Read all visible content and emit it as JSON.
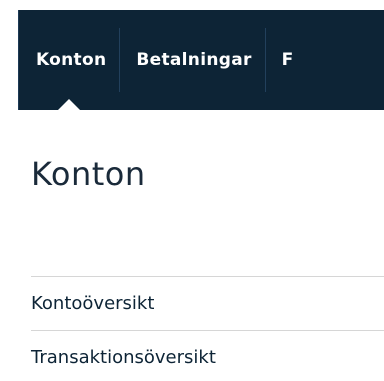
{
  "nav": {
    "items": [
      {
        "label": "Konton",
        "active": true
      },
      {
        "label": "Betalningar",
        "active": false
      },
      {
        "label": "F",
        "active": false
      }
    ]
  },
  "main": {
    "title": "Konton",
    "menu": [
      {
        "label": "Kontoöversikt"
      },
      {
        "label": "Transaktionsöversikt"
      }
    ]
  },
  "colors": {
    "nav_background": "#0d2436",
    "nav_text": "#ffffff",
    "link_text": "#0d2436",
    "divider": "#d6d6d6"
  }
}
